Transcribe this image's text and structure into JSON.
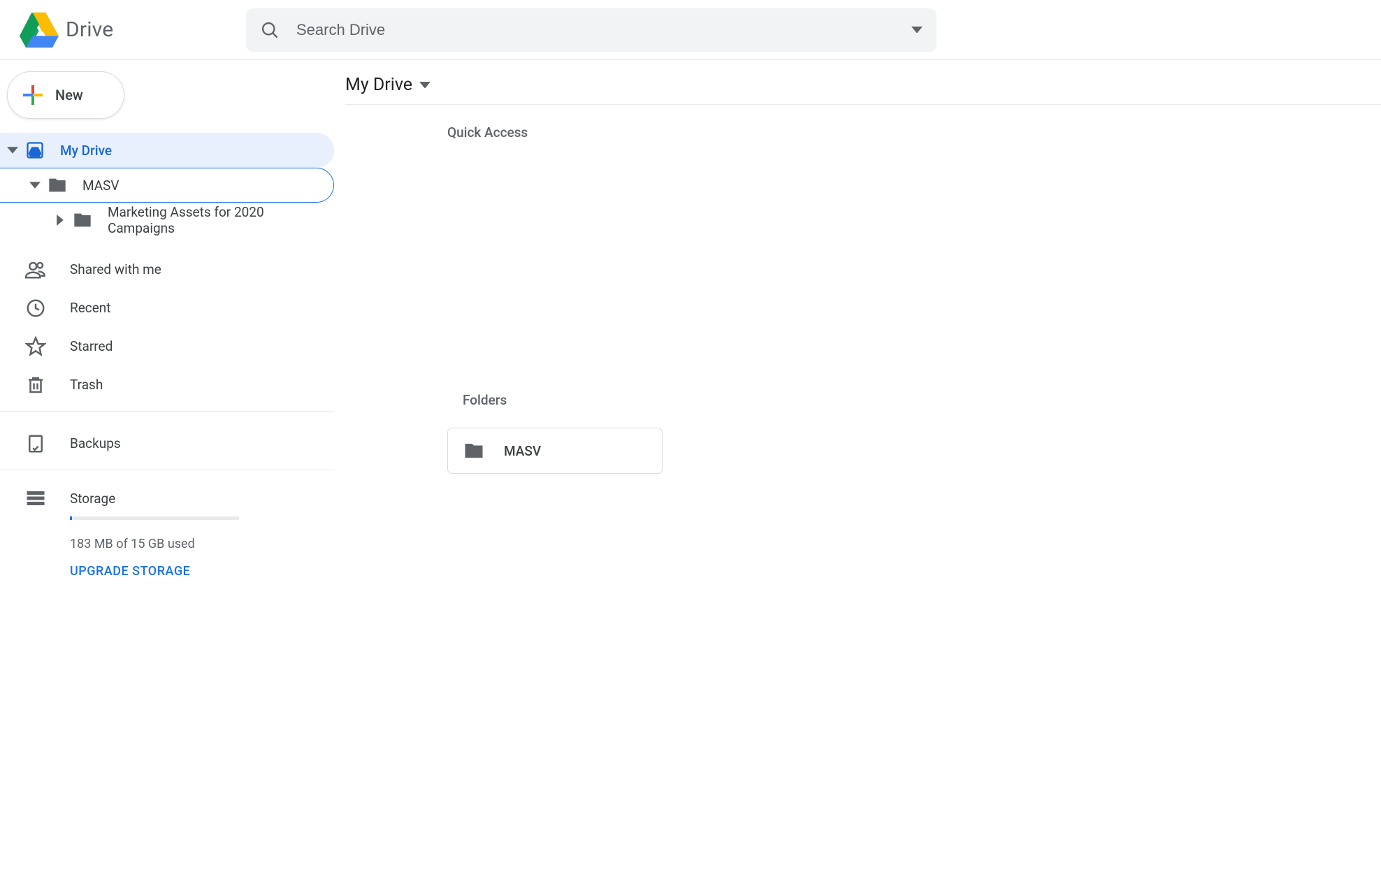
{
  "header": {
    "app_name": "Drive",
    "search_placeholder": "Search Drive"
  },
  "sidebar": {
    "new_button": "New",
    "tree": {
      "root": "My Drive",
      "level1": "MASV",
      "level2": "Marketing Assets for 2020 Campaigns"
    },
    "nav": [
      {
        "icon": "shared",
        "label": "Shared with me"
      },
      {
        "icon": "recent",
        "label": "Recent"
      },
      {
        "icon": "starred",
        "label": "Starred"
      },
      {
        "icon": "trash",
        "label": "Trash"
      }
    ],
    "backups": "Backups",
    "storage": {
      "label": "Storage",
      "usage": "183 MB of 15 GB used",
      "upgrade": "UPGRADE STORAGE",
      "percent": 1.2
    }
  },
  "main": {
    "breadcrumb": "My Drive",
    "quick_access_label": "Quick Access",
    "folders_label": "Folders",
    "folders": [
      {
        "name": "MASV"
      }
    ]
  }
}
